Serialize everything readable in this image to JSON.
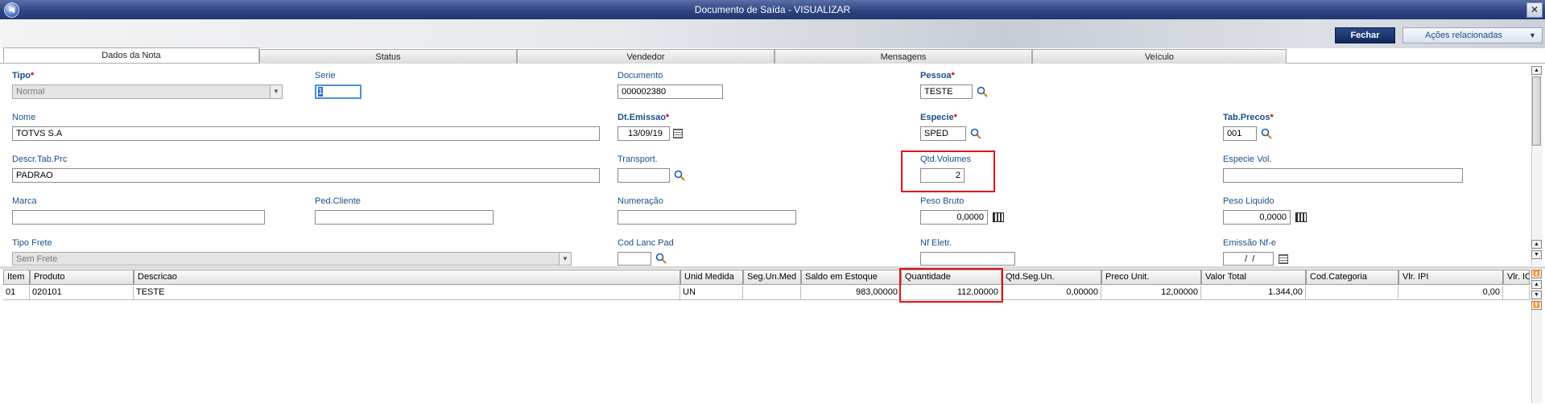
{
  "window": {
    "title": "Documento de Saída - VISUALIZAR",
    "close": "✕"
  },
  "toolbar": {
    "fechar": "Fechar",
    "acoes": "Ações relacionadas"
  },
  "tabs": [
    "Dados da Nota",
    "Status",
    "Vendedor",
    "Mensagens",
    "Veículo"
  ],
  "form": {
    "tipo": {
      "label": "Tipo",
      "value": "Normal"
    },
    "serie": {
      "label": "Serie",
      "value": "1"
    },
    "documento": {
      "label": "Documento",
      "value": "000002380"
    },
    "pessoa": {
      "label": "Pessoa",
      "value": "TESTE"
    },
    "nome": {
      "label": "Nome",
      "value": "TOTVS S.A"
    },
    "dt_emissao": {
      "label": "Dt.Emissao",
      "value": "13/09/19"
    },
    "especie": {
      "label": "Especie",
      "value": "SPED"
    },
    "tab_precos": {
      "label": "Tab.Precos",
      "value": "001"
    },
    "descr_tab": {
      "label": "Descr.Tab.Prc",
      "value": "PADRAO"
    },
    "transport": {
      "label": "Transport.",
      "value": ""
    },
    "qtd_volumes": {
      "label": "Qtd.Volumes",
      "value": "2"
    },
    "especie_vol": {
      "label": "Especie Vol.",
      "value": ""
    },
    "marca": {
      "label": "Marca",
      "value": ""
    },
    "ped_cliente": {
      "label": "Ped.Cliente",
      "value": ""
    },
    "numeracao": {
      "label": "Numeração",
      "value": ""
    },
    "peso_bruto": {
      "label": "Peso Bruto",
      "value": "0,0000"
    },
    "peso_liquido": {
      "label": "Peso Liquido",
      "value": "0,0000"
    },
    "tipo_frete": {
      "label": "Tipo Frete",
      "value": "Sem Frete"
    },
    "cod_lanc": {
      "label": "Cod Lanc Pad",
      "value": ""
    },
    "nf_eletr": {
      "label": "Nf Eletr.",
      "value": ""
    },
    "emissao_nfe": {
      "label": "Emissão Nf-e",
      "value": "  /  /"
    }
  },
  "grid": {
    "columns": [
      "Item",
      "Produto",
      "Descricao",
      "Unid Medida",
      "Seg.Un.Med",
      "Saldo em Estoque",
      "Quantidade",
      "Qtd.Seg.Un.",
      "Preco Unit.",
      "Valor Total",
      "Cod.Categoria",
      "Vlr. IPI",
      "Vlr. IC"
    ],
    "rows": [
      [
        "01",
        "020101",
        "TESTE",
        "UN",
        "",
        "983,00000",
        "112,00000",
        "0,00000",
        "12,00000",
        "1.344,00",
        "",
        "0,00",
        ""
      ]
    ]
  }
}
